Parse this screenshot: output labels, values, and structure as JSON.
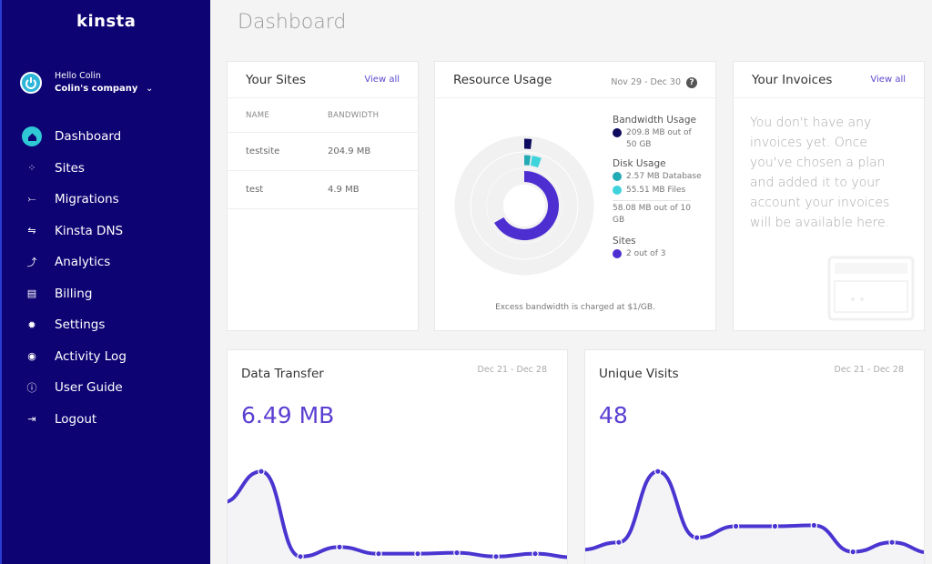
{
  "brand": {
    "logo": "kinsta",
    "accent": "#5b3fd1",
    "sidebar_bg": "#0e0373"
  },
  "user": {
    "greeting": "Hello Colin",
    "company": "Colin's company"
  },
  "sidebar": {
    "items": [
      {
        "label": "Dashboard",
        "icon": "home-icon",
        "active": true
      },
      {
        "label": "Sites",
        "icon": "sites-icon"
      },
      {
        "label": "Migrations",
        "icon": "migrations-icon"
      },
      {
        "label": "Kinsta DNS",
        "icon": "dns-icon"
      },
      {
        "label": "Analytics",
        "icon": "analytics-icon"
      },
      {
        "label": "Billing",
        "icon": "billing-icon"
      },
      {
        "label": "Settings",
        "icon": "gear-icon"
      },
      {
        "label": "Activity Log",
        "icon": "eye-icon"
      },
      {
        "label": "User Guide",
        "icon": "help-circle-icon"
      },
      {
        "label": "Logout",
        "icon": "logout-icon"
      }
    ]
  },
  "page": {
    "title": "Dashboard"
  },
  "sites": {
    "title": "Your Sites",
    "view_all": "View all",
    "columns": [
      "NAME",
      "BANDWIDTH"
    ],
    "rows": [
      {
        "name": "testsite",
        "bandwidth": "204.9 MB"
      },
      {
        "name": "test",
        "bandwidth": "4.9 MB"
      }
    ]
  },
  "resources": {
    "title": "Resource Usage",
    "date_range": "Nov 29 - Dec 30",
    "bandwidth_title": "Bandwidth Usage",
    "bandwidth_text": "209.8 MB out of 50 GB",
    "disk_title": "Disk Usage",
    "disk_db": "2.57 MB Database",
    "disk_files": "55.51 MB Files",
    "disk_total": "58.08 MB out of 10 GB",
    "sites_title": "Sites",
    "sites_text": "2 out of 3",
    "excess_note": "Excess bandwidth is charged at $1/GB.",
    "colors": {
      "bandwidth": "#0e0a5e",
      "database": "#22aab5",
      "files": "#3fd3dc",
      "sites": "#4d2fd1"
    },
    "fractions": {
      "bandwidth": 0.004,
      "database": 0.012,
      "files": 0.03,
      "sites": 0.667
    }
  },
  "invoices": {
    "title": "Your Invoices",
    "view_all": "View all",
    "empty_text": "You don't have any invoices yet. Once you've chosen a plan and added it to your account your invoices will be available here."
  },
  "data_transfer": {
    "title": "Data Transfer",
    "date_range": "Dec 21 - Dec 28",
    "value": "6.49 MB",
    "points": [
      0.62,
      0.95,
      0.05,
      0.15,
      0.08,
      0.08,
      0.09,
      0.05,
      0.08,
      0.04
    ]
  },
  "unique_visits": {
    "title": "Unique Visits",
    "date_range": "Dec 21 - Dec 28",
    "value": "48",
    "points": [
      0.12,
      0.2,
      0.95,
      0.25,
      0.37,
      0.37,
      0.38,
      0.1,
      0.2,
      0.09
    ]
  }
}
